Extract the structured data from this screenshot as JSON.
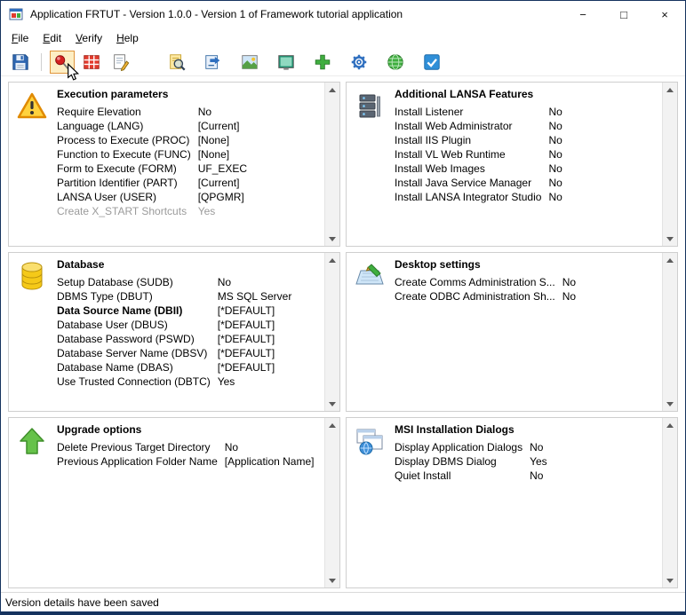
{
  "colors": {
    "window_border": "#15325e",
    "panel_border": "#cfcfcf",
    "toolbar_highlight_border": "#e0953c",
    "toolbar_highlight_bg": "#fdeec4",
    "disabled_text": "#9b9b9b"
  },
  "window": {
    "title": "Application FRTUT - Version 1.0.0 - Version 1 of Framework tutorial application",
    "controls": {
      "minimize": "−",
      "maximize": "□",
      "close": "×"
    }
  },
  "menu": {
    "items": [
      "File",
      "Edit",
      "Verify",
      "Help"
    ]
  },
  "toolbar": {
    "items": [
      {
        "type": "button",
        "icon": "save-icon",
        "name": "save-button"
      },
      {
        "type": "separator"
      },
      {
        "type": "button",
        "icon": "pin-icon",
        "name": "pin-button",
        "highlighted": true
      },
      {
        "type": "button",
        "icon": "versions-grid-icon",
        "name": "versions-button"
      },
      {
        "type": "button",
        "icon": "verify-document-icon",
        "name": "verify-button"
      },
      {
        "type": "gap"
      },
      {
        "type": "button",
        "icon": "find-icon",
        "name": "find-button"
      },
      {
        "type": "button",
        "icon": "export-icon",
        "name": "export-button"
      },
      {
        "type": "button",
        "icon": "image-icon",
        "name": "images-button"
      },
      {
        "type": "button",
        "icon": "media-icon",
        "name": "media-button"
      },
      {
        "type": "button",
        "icon": "add-icon",
        "name": "add-button"
      },
      {
        "type": "button",
        "icon": "settings-gear-icon",
        "name": "settings-button"
      },
      {
        "type": "button",
        "icon": "globe-icon",
        "name": "web-button"
      },
      {
        "type": "button",
        "icon": "deploy-check-icon",
        "name": "deploy-button"
      }
    ]
  },
  "panels": [
    {
      "key": "execution-parameters",
      "title": "Execution parameters",
      "icon": "warning-icon",
      "rows": [
        {
          "label": "Require Elevation",
          "value": "No"
        },
        {
          "label": "Language (LANG)",
          "value": "[Current]"
        },
        {
          "label": "Process to Execute (PROC)",
          "value": "[None]"
        },
        {
          "label": "Function to Execute (FUNC)",
          "value": "[None]"
        },
        {
          "label": "Form to Execute (FORM)",
          "value": "UF_EXEC"
        },
        {
          "label": "Partition Identifier (PART)",
          "value": "[Current]"
        },
        {
          "label": "LANSA User (USER)",
          "value": "[QPGMR]"
        },
        {
          "label": "Create X_START Shortcuts",
          "value": "Yes",
          "disabled": true
        }
      ]
    },
    {
      "key": "additional-lansa-features",
      "title": "Additional LANSA Features",
      "icon": "server-stack-icon",
      "rows": [
        {
          "label": "Install Listener",
          "value": "No"
        },
        {
          "label": "Install Web Administrator",
          "value": "No"
        },
        {
          "label": "Install IIS Plugin",
          "value": "No"
        },
        {
          "label": "Install VL Web Runtime",
          "value": "No"
        },
        {
          "label": "Install Web Images",
          "value": "No"
        },
        {
          "label": "Install Java Service Manager",
          "value": "No"
        },
        {
          "label": "Install LANSA Integrator Studio",
          "value": "No"
        }
      ]
    },
    {
      "key": "database",
      "title": "Database",
      "icon": "database-icon",
      "rows": [
        {
          "label": "Setup Database (SUDB)",
          "value": "No"
        },
        {
          "label": "DBMS Type (DBUT)",
          "value": "MS SQL Server"
        },
        {
          "label": "Data Source Name (DBII)",
          "value": "[*DEFAULT]",
          "bold": true
        },
        {
          "label": "Database User (DBUS)",
          "value": "[*DEFAULT]"
        },
        {
          "label": "Database Password (PSWD)",
          "value": "[*DEFAULT]"
        },
        {
          "label": "Database Server Name (DBSV)",
          "value": "[*DEFAULT]"
        },
        {
          "label": "Database Name (DBAS)",
          "value": "[*DEFAULT]"
        },
        {
          "label": "Use Trusted Connection (DBTC)",
          "value": "Yes"
        }
      ]
    },
    {
      "key": "desktop-settings",
      "title": "Desktop settings",
      "icon": "desktop-settings-icon",
      "rows": [
        {
          "label": "Create Comms Administration S...",
          "value": "No"
        },
        {
          "label": "Create ODBC Administration Sh...",
          "value": "No"
        }
      ]
    },
    {
      "key": "upgrade-options",
      "title": "Upgrade options",
      "icon": "upgrade-arrow-icon",
      "rows": [
        {
          "label": "Delete Previous Target Directory",
          "value": "No"
        },
        {
          "label": "Previous Application Folder Name",
          "value": "[Application Name]"
        }
      ]
    },
    {
      "key": "msi-installation-dialogs",
      "title": "MSI Installation Dialogs",
      "icon": "msi-dialogs-icon",
      "rows": [
        {
          "label": "Display Application Dialogs",
          "value": "No"
        },
        {
          "label": "Display DBMS Dialog",
          "value": "Yes"
        },
        {
          "label": "Quiet Install",
          "value": "No"
        }
      ]
    }
  ],
  "statusbar": {
    "text": "Version details have been saved"
  }
}
